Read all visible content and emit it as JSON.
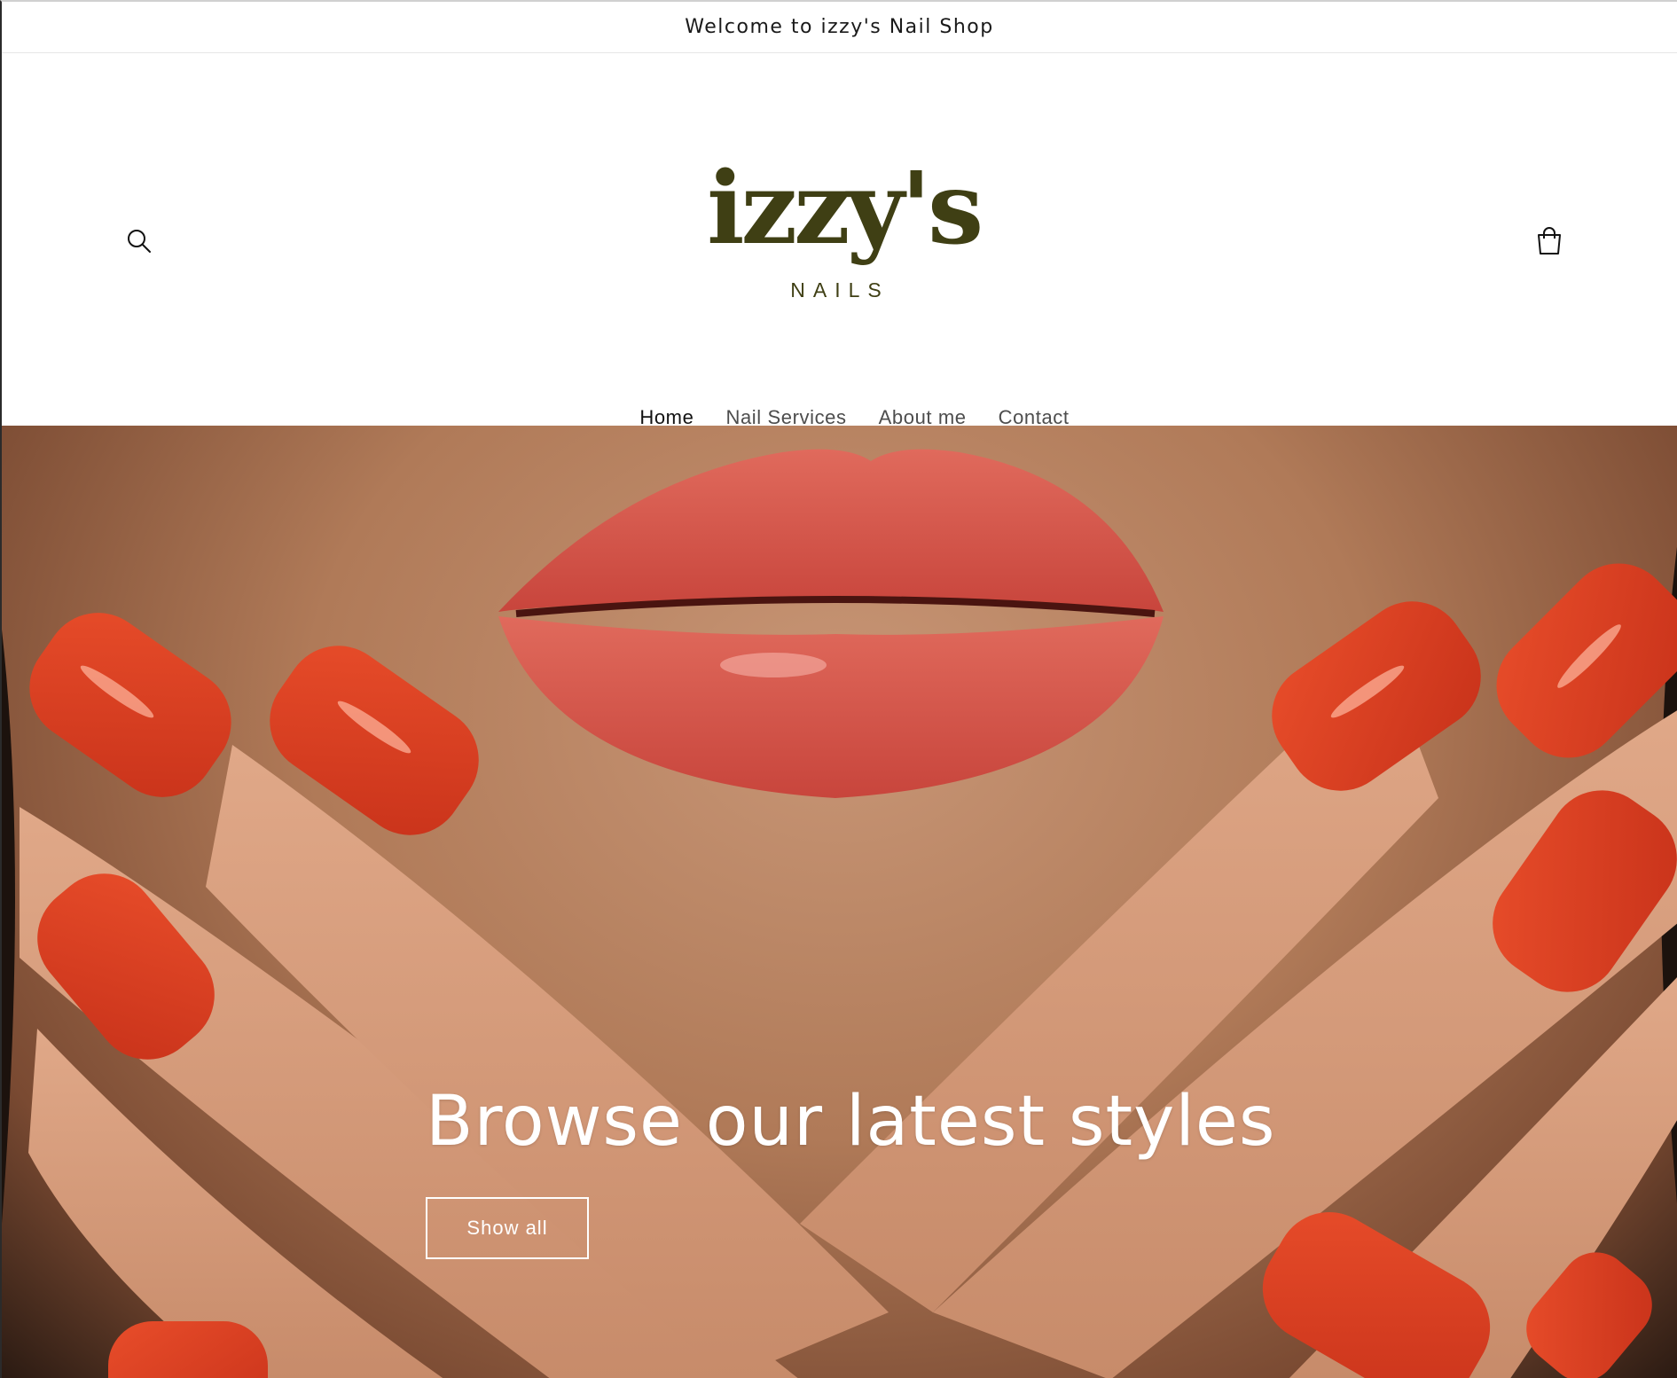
{
  "announcement": {
    "text": "Welcome to izzy's Nail Shop"
  },
  "header": {
    "logo": {
      "wordmark": "izzy's",
      "subtitle": "NAILS"
    },
    "icons": {
      "search": "search-icon",
      "cart": "cart-icon"
    }
  },
  "nav": {
    "items": [
      {
        "label": "Home",
        "active": true
      },
      {
        "label": "Nail Services",
        "active": false
      },
      {
        "label": "About me",
        "active": false
      },
      {
        "label": "Contact",
        "active": false
      }
    ]
  },
  "hero": {
    "title": "Browse our latest styles",
    "button_label": "Show all"
  },
  "colors": {
    "logo": "#3f3f14",
    "nail": "#d63a1e",
    "lips": "#d9534a",
    "skin": "#c89676"
  }
}
